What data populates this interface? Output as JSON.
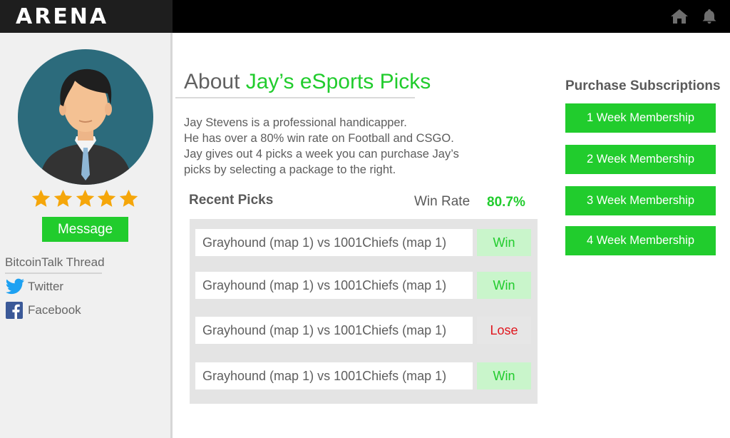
{
  "app": {
    "logo_text": "ARENA"
  },
  "topbar": {
    "icons": [
      "home-icon",
      "bell-icon"
    ]
  },
  "profile": {
    "rating_stars": 5,
    "message_label": "Message",
    "thread_label": "BitcoinTalk Thread",
    "twitter_label": "Twitter",
    "facebook_label": "Facebook"
  },
  "about": {
    "title_prefix": "About ",
    "title_accent": "Jay’s eSports Picks",
    "description": [
      "Jay Stevens is a professional handicapper.",
      "He has over a 80% win rate on Football and CSGO.",
      "Jay gives out 4 picks a week you can purchase Jay’s",
      "picks by selecting a package to the right."
    ]
  },
  "picks": {
    "heading": "Recent Picks",
    "win_rate_label": "Win Rate",
    "win_rate_value": "80.7%",
    "items": [
      {
        "match": "Grayhound (map 1) vs 1001Chiefs (map 1)",
        "result": "Win"
      },
      {
        "match": "Grayhound (map 1) vs 1001Chiefs (map 1)",
        "result": "Win"
      },
      {
        "match": "Grayhound (map 1) vs 1001Chiefs (map 1)",
        "result": "Lose"
      },
      {
        "match": "Grayhound (map 1) vs 1001Chiefs (map 1)",
        "result": "Win"
      }
    ]
  },
  "subscriptions": {
    "heading": "Purchase Subscriptions",
    "options": [
      "1 Week Membership",
      "2 Week Membership",
      "3 Week Membership",
      "4 Week Membership"
    ]
  },
  "colors": {
    "accent_green": "#21cc2d",
    "lose_red": "#e0161e",
    "topbar": "#000000"
  }
}
